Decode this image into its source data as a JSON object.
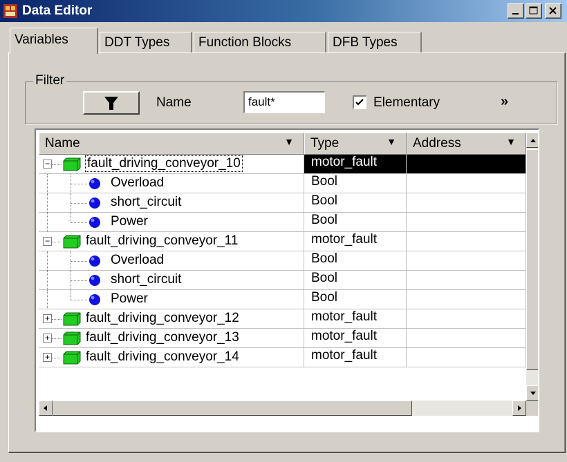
{
  "window": {
    "title": "Data Editor",
    "minimize_label": "_",
    "maximize_label": "□",
    "close_label": "✕"
  },
  "tabs": [
    {
      "label": "Variables",
      "active": true
    },
    {
      "label": "DDT Types",
      "active": false
    },
    {
      "label": "Function Blocks",
      "active": false
    },
    {
      "label": "DFB Types",
      "active": false
    }
  ],
  "filter": {
    "legend": "Filter",
    "name_label": "Name",
    "name_value": "fault*",
    "elementary_label": "Elementary",
    "elementary_checked": true,
    "more_label": "»"
  },
  "table": {
    "columns": [
      {
        "label": "Name"
      },
      {
        "label": "Type"
      },
      {
        "label": "Address"
      }
    ],
    "rows": [
      {
        "name": "fault_driving_conveyor_10",
        "type": "motor_fault",
        "kind": "struct",
        "level": 0,
        "expander": "minus",
        "selected": true
      },
      {
        "name": "Overload",
        "type": "Bool",
        "kind": "bool",
        "level": 1
      },
      {
        "name": "short_circuit",
        "type": "Bool",
        "kind": "bool",
        "level": 1
      },
      {
        "name": "Power",
        "type": "Bool",
        "kind": "bool",
        "level": 1
      },
      {
        "name": "fault_driving_conveyor_11",
        "type": "motor_fault",
        "kind": "struct",
        "level": 0,
        "expander": "minus"
      },
      {
        "name": "Overload",
        "type": "Bool",
        "kind": "bool",
        "level": 1
      },
      {
        "name": "short_circuit",
        "type": "Bool",
        "kind": "bool",
        "level": 1
      },
      {
        "name": "Power",
        "type": "Bool",
        "kind": "bool",
        "level": 1
      },
      {
        "name": "fault_driving_conveyor_12",
        "type": "motor_fault",
        "kind": "struct",
        "level": 0,
        "expander": "plus"
      },
      {
        "name": "fault_driving_conveyor_13",
        "type": "motor_fault",
        "kind": "struct",
        "level": 0,
        "expander": "plus"
      },
      {
        "name": "fault_driving_conveyor_14",
        "type": "motor_fault",
        "kind": "struct",
        "level": 0,
        "expander": "plus"
      }
    ]
  },
  "colors": {
    "struct_icon": "#22cc22",
    "bool_icon": "#1010e0",
    "titlebar_start": "#0a246a"
  }
}
